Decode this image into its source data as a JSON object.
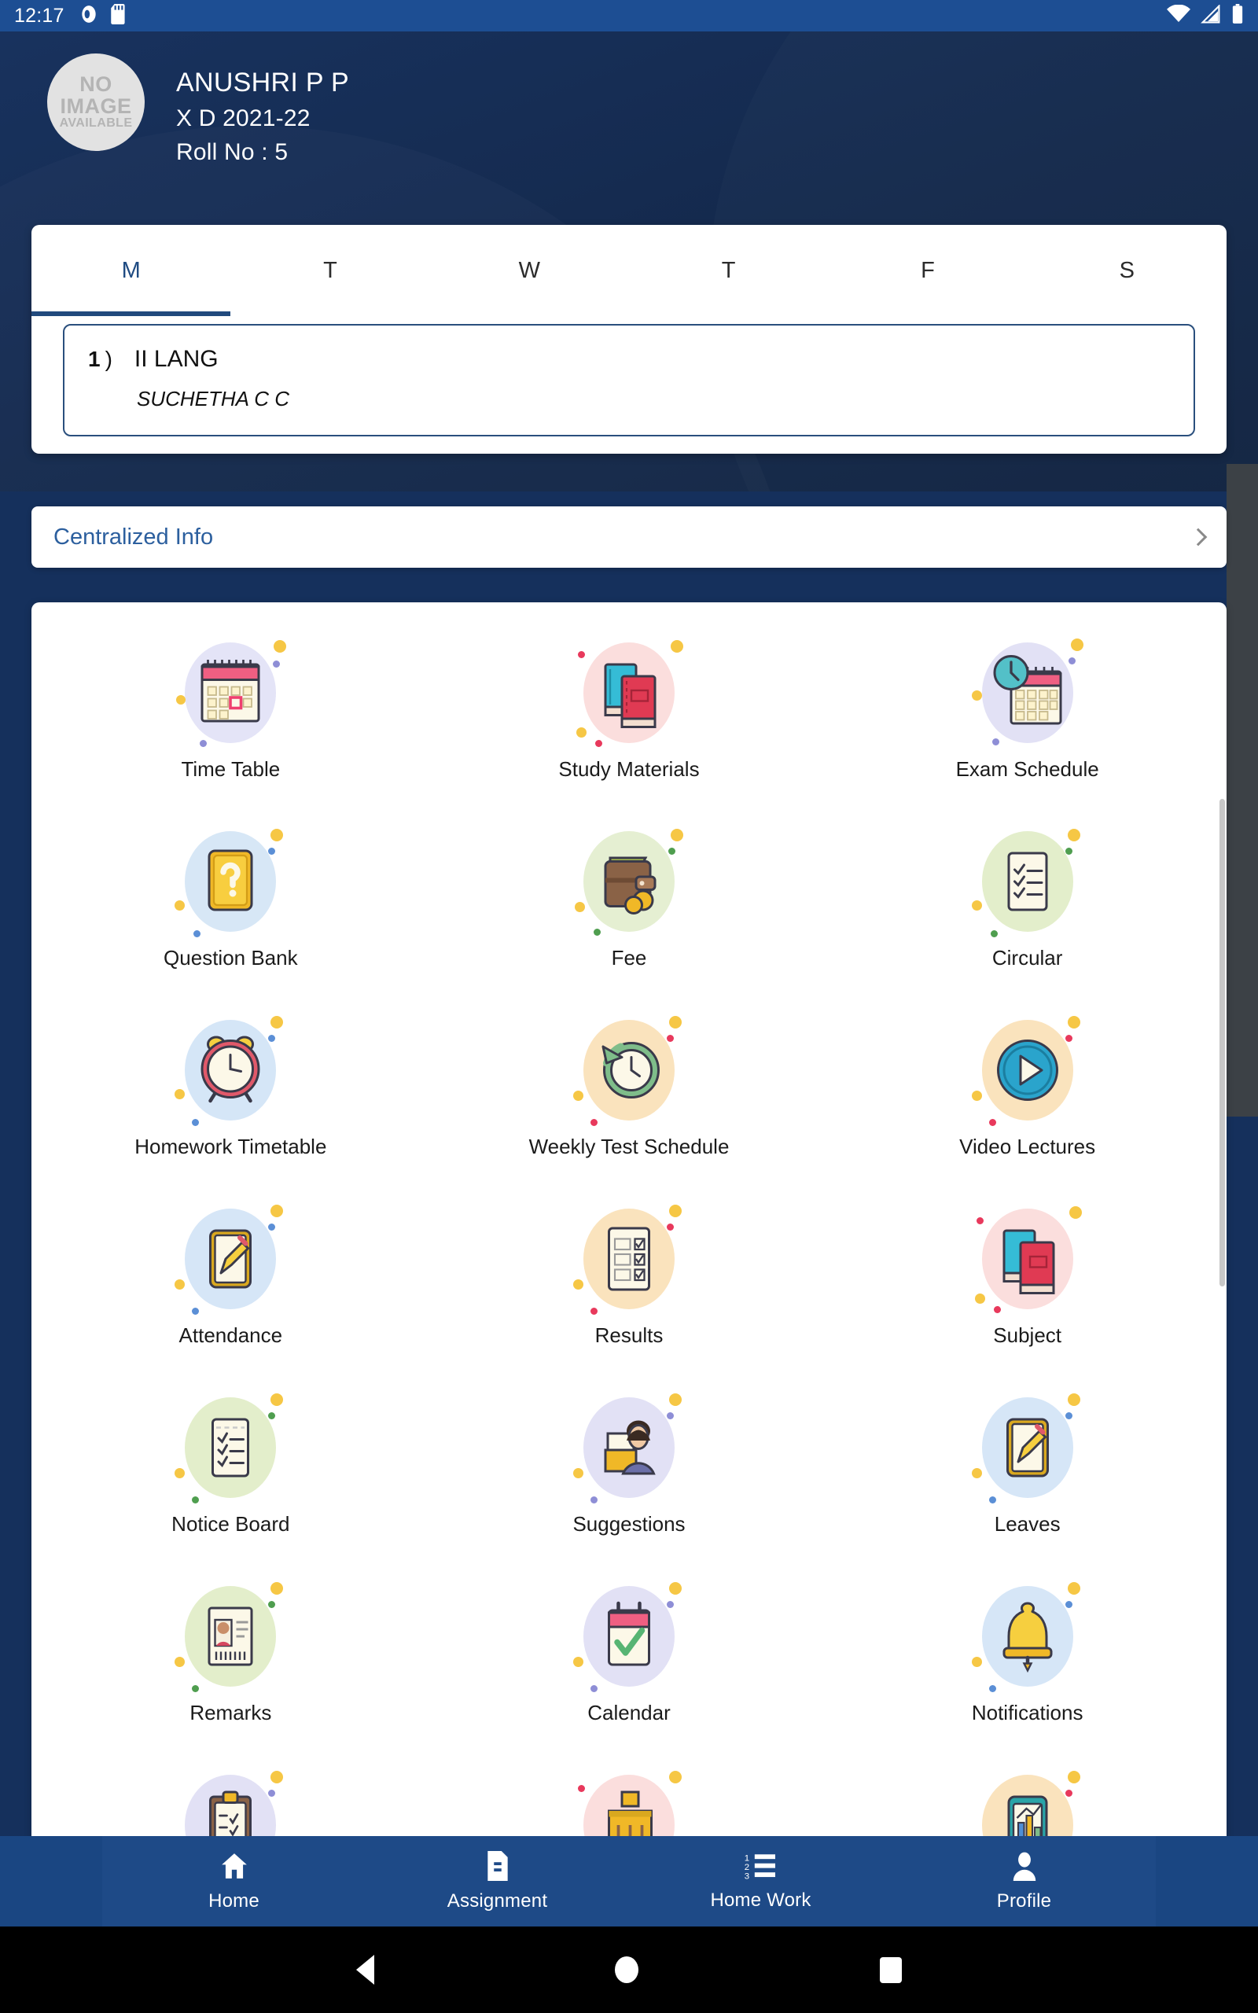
{
  "status_bar": {
    "time": "12:17",
    "left_icons": [
      "screen-record-icon",
      "sd-card-icon"
    ],
    "right_icons": [
      "wifi-icon",
      "cellular-signal-icon",
      "battery-icon"
    ]
  },
  "profile": {
    "avatar_text": [
      "NO",
      "IMAGE",
      "AVAILABLE"
    ],
    "name": "ANUSHRI P P",
    "class": "X D 2021-22",
    "roll": "Roll No : 5"
  },
  "timetable": {
    "days": [
      {
        "label": "M",
        "active": true
      },
      {
        "label": "T",
        "active": false
      },
      {
        "label": "W",
        "active": false
      },
      {
        "label": "T",
        "active": false
      },
      {
        "label": "F",
        "active": false
      },
      {
        "label": "S",
        "active": false
      }
    ],
    "periods": [
      {
        "number": "1",
        "paren": ")",
        "subject": "II LANG",
        "teacher": "SUCHETHA C C"
      }
    ]
  },
  "centralized_info": {
    "label": "Centralized Info",
    "chevron": "chevron-right-icon"
  },
  "menu": {
    "items": [
      {
        "label": "Time Table",
        "icon": "calendar-icon",
        "blob": "#e4e4f7"
      },
      {
        "label": "Study Materials",
        "icon": "books-icon",
        "blob": "#fbdedd"
      },
      {
        "label": "Exam Schedule",
        "icon": "clock-calendar-icon",
        "blob": "#e2e1f5"
      },
      {
        "label": "Question Bank",
        "icon": "question-card-icon",
        "blob": "#d7e7f6"
      },
      {
        "label": "Fee",
        "icon": "wallet-icon",
        "blob": "#e5efd2"
      },
      {
        "label": "Circular",
        "icon": "checklist-icon",
        "blob": "#e3eecb"
      },
      {
        "label": "Homework Timetable",
        "icon": "alarm-clock-icon",
        "blob": "#d5e6f7"
      },
      {
        "label": "Weekly Test Schedule",
        "icon": "clock-refresh-icon",
        "blob": "#fae3bd"
      },
      {
        "label": "Video Lectures",
        "icon": "play-button-icon",
        "blob": "#fae3bd"
      },
      {
        "label": "Attendance",
        "icon": "edit-tablet-icon",
        "blob": "#d6e6f7"
      },
      {
        "label": "Results",
        "icon": "results-list-icon",
        "blob": "#fae3bd"
      },
      {
        "label": "Subject",
        "icon": "books-icon",
        "blob": "#fbdedd"
      },
      {
        "label": "Notice Board",
        "icon": "checklist-icon",
        "blob": "#e3eecb"
      },
      {
        "label": "Suggestions",
        "icon": "person-files-icon",
        "blob": "#e2e1f5"
      },
      {
        "label": "Leaves",
        "icon": "edit-tablet-icon",
        "blob": "#d6e6f7"
      },
      {
        "label": "Remarks",
        "icon": "id-card-icon",
        "blob": "#e3eecb"
      },
      {
        "label": "Calendar",
        "icon": "calendar-check-icon",
        "blob": "#e2e1f5"
      },
      {
        "label": "Notifications",
        "icon": "bell-icon",
        "blob": "#d6e6f7"
      },
      {
        "label": "",
        "icon": "clipboard-icon",
        "blob": "#e2e1f5"
      },
      {
        "label": "",
        "icon": "school-building-icon",
        "blob": "#fbdedd"
      },
      {
        "label": "",
        "icon": "chart-phone-icon",
        "blob": "#fae3bd"
      }
    ]
  },
  "bottom_nav": {
    "items": [
      {
        "label": "Home",
        "icon": "home-icon",
        "active": true
      },
      {
        "label": "Assignment",
        "icon": "document-icon",
        "active": false
      },
      {
        "label": "Home Work",
        "icon": "numbered-list-icon",
        "active": false
      },
      {
        "label": "Profile",
        "icon": "person-icon",
        "active": false
      }
    ]
  },
  "android_nav": {
    "back": "back-triangle-icon",
    "home": "home-circle-icon",
    "recents": "recents-square-icon"
  },
  "colors": {
    "status_bar": "#1d4e93",
    "header": "#15305c",
    "accent": "#214a7d",
    "link": "#2c5f9e",
    "bottom_nav": "#1e4a87"
  }
}
